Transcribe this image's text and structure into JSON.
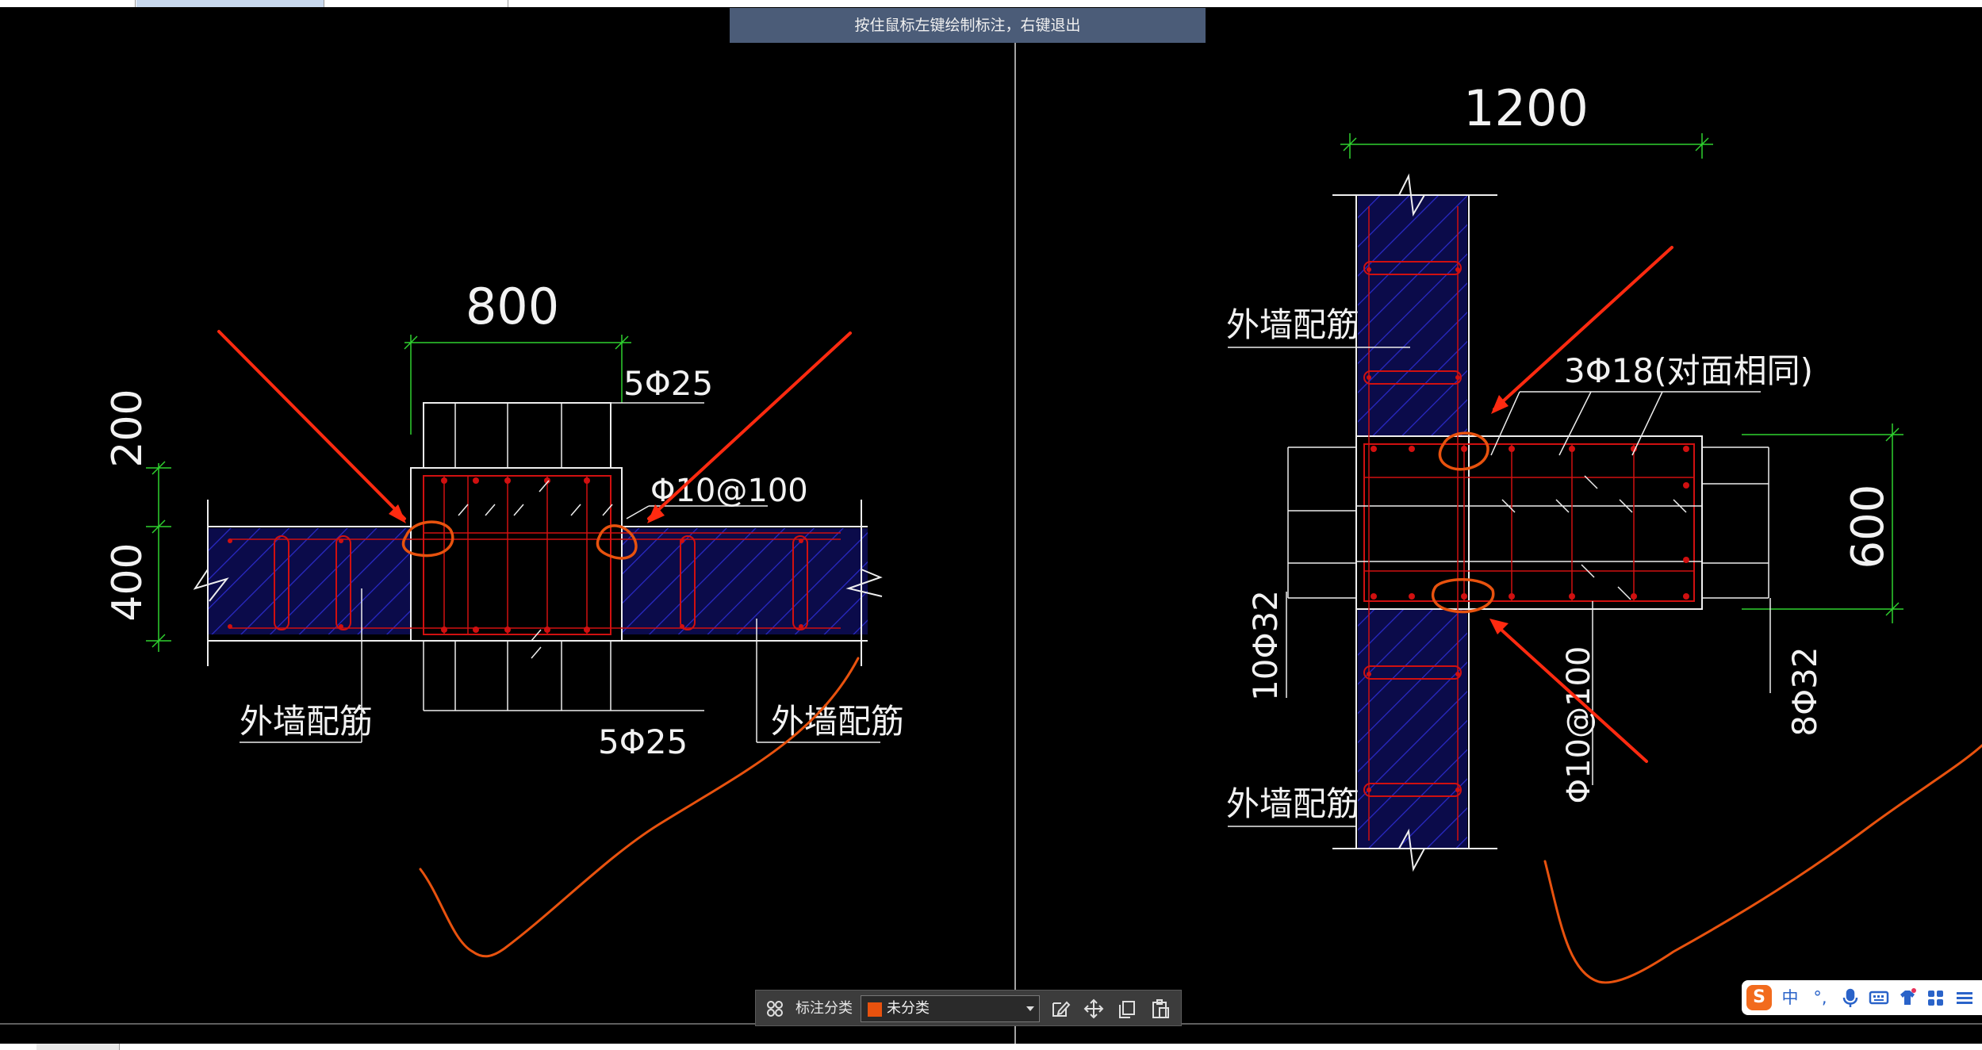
{
  "tabs": [
    {
      "label": ""
    },
    {
      "label": ""
    },
    {
      "label": ""
    }
  ],
  "hint": {
    "text": "按住鼠标左键绘制标注，右键退出"
  },
  "drawing_left": {
    "dim_width": "800",
    "dim_top": "200",
    "dim_bottom": "400",
    "rebar_top": "5Φ25",
    "rebar_bottom": "5Φ25",
    "stirrup": "Φ10@100",
    "wall_label_left": "外墙配筋",
    "wall_label_right": "外墙配筋"
  },
  "drawing_right": {
    "dim_width": "1200",
    "dim_height": "600",
    "rebar_main": "3Φ18(对面相同)",
    "rebar_left": "10Φ32",
    "rebar_right": "8Φ32",
    "stirrup": "Φ10@100",
    "wall_label_top": "外墙配筋",
    "wall_label_bottom": "外墙配筋"
  },
  "toolbar": {
    "category_label": "标注分类",
    "category_value": "未分类",
    "swatch_color": "#e8520e"
  },
  "ime": {
    "lang": "中",
    "punct": "°,",
    "items": [
      "mic-icon",
      "keyboard-icon",
      "skin-icon",
      "grid-icon",
      "menu-icon"
    ]
  },
  "colors": {
    "annotation": "#e8520e",
    "arrow": "#ff2a10",
    "dimension": "#2fd12f",
    "rebar": "#d01010",
    "hatch": "#2a2ac8",
    "fill": "#0b0b4a"
  }
}
